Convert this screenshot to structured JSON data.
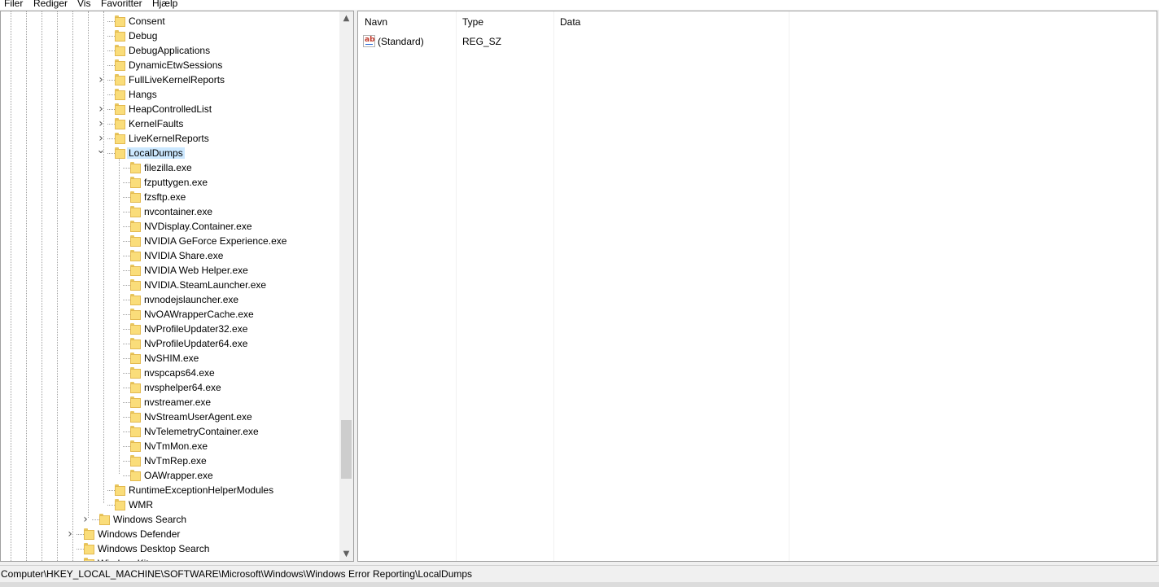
{
  "menu": [
    "Filer",
    "Rediger",
    "Vis",
    "Favoritter",
    "Hjælp"
  ],
  "tree": {
    "items": [
      {
        "label": "Consent",
        "level": 2,
        "expander": "none"
      },
      {
        "label": "Debug",
        "level": 2,
        "expander": "none"
      },
      {
        "label": "DebugApplications",
        "level": 2,
        "expander": "none"
      },
      {
        "label": "DynamicEtwSessions",
        "level": 2,
        "expander": "none"
      },
      {
        "label": "FullLiveKernelReports",
        "level": 2,
        "expander": "collapsed"
      },
      {
        "label": "Hangs",
        "level": 2,
        "expander": "none"
      },
      {
        "label": "HeapControlledList",
        "level": 2,
        "expander": "collapsed"
      },
      {
        "label": "KernelFaults",
        "level": 2,
        "expander": "collapsed"
      },
      {
        "label": "LiveKernelReports",
        "level": 2,
        "expander": "collapsed"
      },
      {
        "label": "LocalDumps",
        "level": 2,
        "expander": "expanded",
        "selected": true
      },
      {
        "label": "filezilla.exe",
        "level": 3,
        "expander": "none"
      },
      {
        "label": "fzputtygen.exe",
        "level": 3,
        "expander": "none"
      },
      {
        "label": "fzsftp.exe",
        "level": 3,
        "expander": "none"
      },
      {
        "label": "nvcontainer.exe",
        "level": 3,
        "expander": "none"
      },
      {
        "label": "NVDisplay.Container.exe",
        "level": 3,
        "expander": "none"
      },
      {
        "label": "NVIDIA GeForce Experience.exe",
        "level": 3,
        "expander": "none"
      },
      {
        "label": "NVIDIA Share.exe",
        "level": 3,
        "expander": "none"
      },
      {
        "label": "NVIDIA Web Helper.exe",
        "level": 3,
        "expander": "none"
      },
      {
        "label": "NVIDIA.SteamLauncher.exe",
        "level": 3,
        "expander": "none"
      },
      {
        "label": "nvnodejslauncher.exe",
        "level": 3,
        "expander": "none"
      },
      {
        "label": "NvOAWrapperCache.exe",
        "level": 3,
        "expander": "none"
      },
      {
        "label": "NvProfileUpdater32.exe",
        "level": 3,
        "expander": "none"
      },
      {
        "label": "NvProfileUpdater64.exe",
        "level": 3,
        "expander": "none"
      },
      {
        "label": "NvSHIM.exe",
        "level": 3,
        "expander": "none"
      },
      {
        "label": "nvspcaps64.exe",
        "level": 3,
        "expander": "none"
      },
      {
        "label": "nvsphelper64.exe",
        "level": 3,
        "expander": "none"
      },
      {
        "label": "nvstreamer.exe",
        "level": 3,
        "expander": "none"
      },
      {
        "label": "NvStreamUserAgent.exe",
        "level": 3,
        "expander": "none"
      },
      {
        "label": "NvTelemetryContainer.exe",
        "level": 3,
        "expander": "none"
      },
      {
        "label": "NvTmMon.exe",
        "level": 3,
        "expander": "none"
      },
      {
        "label": "NvTmRep.exe",
        "level": 3,
        "expander": "none"
      },
      {
        "label": "OAWrapper.exe",
        "level": 3,
        "expander": "none"
      },
      {
        "label": "RuntimeExceptionHelperModules",
        "level": 2,
        "expander": "none"
      },
      {
        "label": "WMR",
        "level": 2,
        "expander": "none"
      },
      {
        "label": "Windows Search",
        "level": 1,
        "expander": "collapsed"
      },
      {
        "label": "Windows Defender",
        "level": 0,
        "expander": "collapsed"
      },
      {
        "label": "Windows Desktop Search",
        "level": 0,
        "expander": "none"
      },
      {
        "label": "WindowsKits",
        "level": 0,
        "expander": "none"
      }
    ]
  },
  "list": {
    "columns": [
      "Navn",
      "Type",
      "Data"
    ],
    "rows": [
      {
        "icon": "string-value-icon",
        "icon_text": "ab",
        "name": "(Standard)",
        "type": "REG_SZ",
        "data": ""
      }
    ]
  },
  "status": {
    "path": "Computer\\HKEY_LOCAL_MACHINE\\SOFTWARE\\Microsoft\\Windows\\Windows Error Reporting\\LocalDumps"
  },
  "colors": {
    "selection": "#cce8ff",
    "folder": "#fadd7a",
    "folder_border": "#e3b94f"
  }
}
